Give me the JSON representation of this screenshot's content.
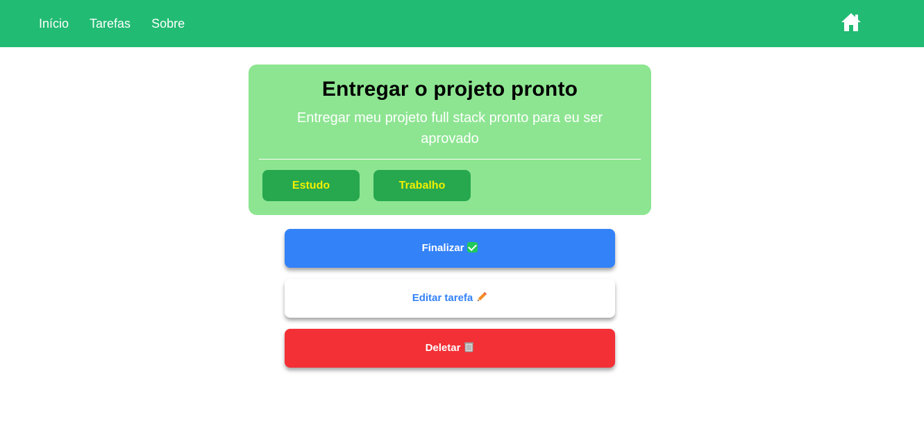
{
  "nav": {
    "links": [
      "Início",
      "Tarefas",
      "Sobre"
    ],
    "home_icon": "home-icon",
    "bg_color": "#22bb73"
  },
  "task": {
    "title": "Entregar o projeto pronto",
    "description": "Entregar meu projeto full stack pronto para eu ser aprovado",
    "tags": [
      "Estudo",
      "Trabalho"
    ],
    "card_color": "#8de591"
  },
  "actions": {
    "finalize_label": "Finalizar",
    "finalize_icon": "check-icon",
    "edit_label": "Editar tarefa",
    "edit_icon": "pencil-icon",
    "delete_label": "Deletar",
    "delete_icon": "trash-icon",
    "colors": {
      "finalize": "#3382f8",
      "edit": "#ffffff",
      "delete": "#f33035"
    }
  }
}
